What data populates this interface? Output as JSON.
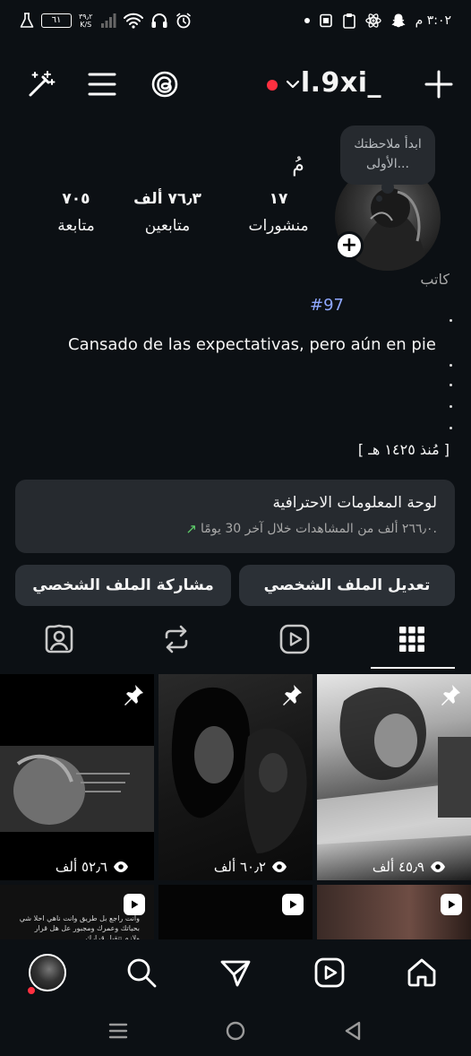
{
  "status_bar": {
    "time": "٣:٠٢ م",
    "battery": "٦١",
    "net_speed_value": "٣٩٫٢",
    "net_speed_unit": "K/S"
  },
  "header": {
    "username": "l.9xi_",
    "live_color": "#ff3040"
  },
  "profile": {
    "note_text": "ابدأ ملاحظتك الأولى...",
    "name_mark": "مُ",
    "stats": [
      {
        "value": "١٧",
        "label": "منشورات"
      },
      {
        "value": "٧٦٫٣ ألف",
        "label": "متابعين"
      },
      {
        "value": "٧٠٥",
        "label": "متابعة"
      }
    ],
    "category": "كاتب",
    "hashtag": "#97",
    "bio_line": "Cansado de las expectativas, pero aún en pie",
    "since": "[ مُنذ ١٤٢٥ هـ ]"
  },
  "dashboard": {
    "title": "لوحة المعلومات الاحترافية",
    "subtitle": "٢٦٦٫٠ ألف من المشاهدات خلال آخر 30 يومًا.",
    "trend_color": "#5fd16b"
  },
  "actions": {
    "edit_profile": "تعديل الملف الشخصي",
    "share_profile": "مشاركة الملف الشخصي"
  },
  "tabs": {
    "active": "grid-tab",
    "items": [
      "grid-tab",
      "reels-tab",
      "reposts-tab",
      "tagged-tab"
    ]
  },
  "grid": {
    "posts": [
      {
        "views": "٤٥٫٩ ألف",
        "pinned": true
      },
      {
        "views": "٦٠٫٢ ألف",
        "pinned": true
      },
      {
        "views": "٥٢٫٦ ألف",
        "pinned": true
      }
    ],
    "caption_snippet": "وانت راجع بل طريق وانت ناهي احلا شي بحياتك وعمرك ومجبور عل هل قرار ولازم تتقبل قرارك"
  },
  "accent_colors": {
    "background": "#0c1014",
    "surface": "#262a2f",
    "hashtag": "#8fa8ff"
  }
}
